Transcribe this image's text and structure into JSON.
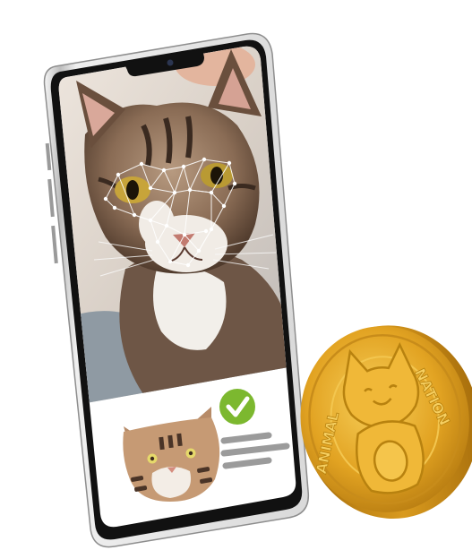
{
  "scene": {
    "description_free": true
  },
  "phone": {
    "screen": {
      "photo_subject_icon": "cat-photo",
      "face_scan_overlay_icon": "face-landmark-mesh-icon",
      "result_card": {
        "cat_icon": "cat-face-icon",
        "check_icon": "check-circle-icon",
        "check_color": "#7cb82f",
        "text_lines": 3
      }
    }
  },
  "coin": {
    "icon": "cat-emblem-icon",
    "embossed_text_left": "ANIMAL",
    "embossed_text_right": "NATION",
    "color": "#e3a520"
  }
}
